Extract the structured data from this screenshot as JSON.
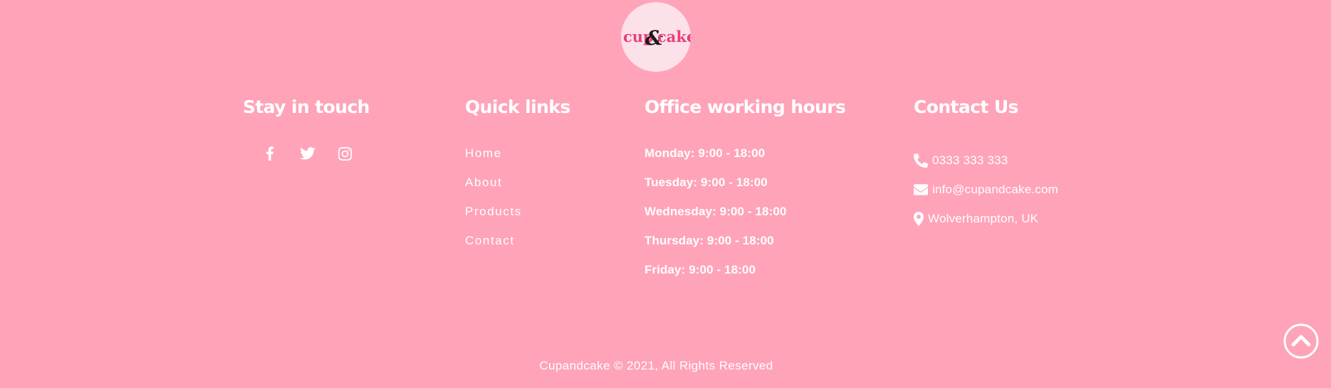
{
  "logo": {
    "part1": "cup",
    "amp": "&",
    "part2": "cake",
    "icon": "cupandcake-logo"
  },
  "sections": {
    "stay_in_touch": {
      "title": "Stay in touch",
      "social": [
        {
          "icon": "facebook-icon"
        },
        {
          "icon": "twitter-icon"
        },
        {
          "icon": "instagram-icon"
        }
      ]
    },
    "quick_links": {
      "title": "Quick links",
      "items": [
        "Home",
        "About",
        "Products",
        "Contact"
      ]
    },
    "office_hours": {
      "title": "Office working hours",
      "items": [
        "Monday: 9:00 - 18:00",
        "Tuesday: 9:00 - 18:00",
        "Wednesday: 9:00 - 18:00",
        "Thursday: 9:00 - 18:00",
        "Friday: 9:00 - 18:00"
      ]
    },
    "contact_us": {
      "title": "Contact Us",
      "phone": "0333 333 333",
      "email": "info@cupandcake.com",
      "address": "Wolverhampton, UK"
    }
  },
  "copyright": "Cupandcake © 2021, All Rights Reserved",
  "colors": {
    "background": "#ffa3b9",
    "logo_bg": "#fde1e8",
    "brand_pink": "#e8407a",
    "text": "#ffffff"
  },
  "scroll_top": {
    "icon": "chevron-up-circle-icon"
  }
}
